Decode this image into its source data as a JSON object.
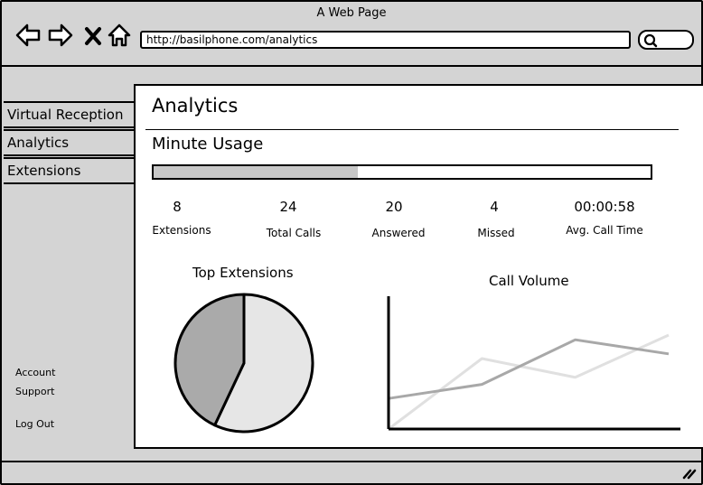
{
  "window": {
    "title": "A Web Page"
  },
  "browser": {
    "url": "http://basilphone.com/analytics",
    "back_icon": "arrow-left-icon",
    "forward_icon": "arrow-right-icon",
    "close_icon": "close-icon",
    "home_icon": "home-icon",
    "search_icon": "search-icon"
  },
  "sidebar": {
    "items": [
      {
        "label": "Virtual Reception"
      },
      {
        "label": "Analytics"
      },
      {
        "label": "Extensions"
      }
    ],
    "links": [
      {
        "label": "Account"
      },
      {
        "label": "Support"
      },
      {
        "label": "Log Out"
      }
    ]
  },
  "main": {
    "title": "Analytics",
    "section_title": "Minute Usage",
    "minute_usage_progress": 0.41,
    "stats": [
      {
        "value": "8",
        "label": "Extensions"
      },
      {
        "value": "24",
        "label": "Total Calls"
      },
      {
        "value": "20",
        "label": "Answered"
      },
      {
        "value": "4",
        "label": "Missed"
      },
      {
        "value": "00:00:58",
        "label": "Avg. Call Time"
      }
    ]
  },
  "chart_data": [
    {
      "type": "pie",
      "title": "Top Extensions",
      "slices": [
        {
          "value": 57,
          "color": "#e6e6e6"
        },
        {
          "value": 43,
          "color": "#aaaaaa"
        }
      ]
    },
    {
      "type": "line",
      "title": "Call Volume",
      "x": [
        0,
        1,
        2,
        3
      ],
      "series": [
        {
          "values": [
            0,
            30,
            22,
            40
          ],
          "color": "#e0e0e0"
        },
        {
          "values": [
            13,
            19,
            38,
            32
          ],
          "color": "#a8a8a8"
        }
      ],
      "ylim": [
        0,
        50
      ],
      "grid": false
    }
  ],
  "colors": {
    "chrome": "#d4d4d4",
    "fill": "#c8c8c8",
    "border": "#000000"
  }
}
